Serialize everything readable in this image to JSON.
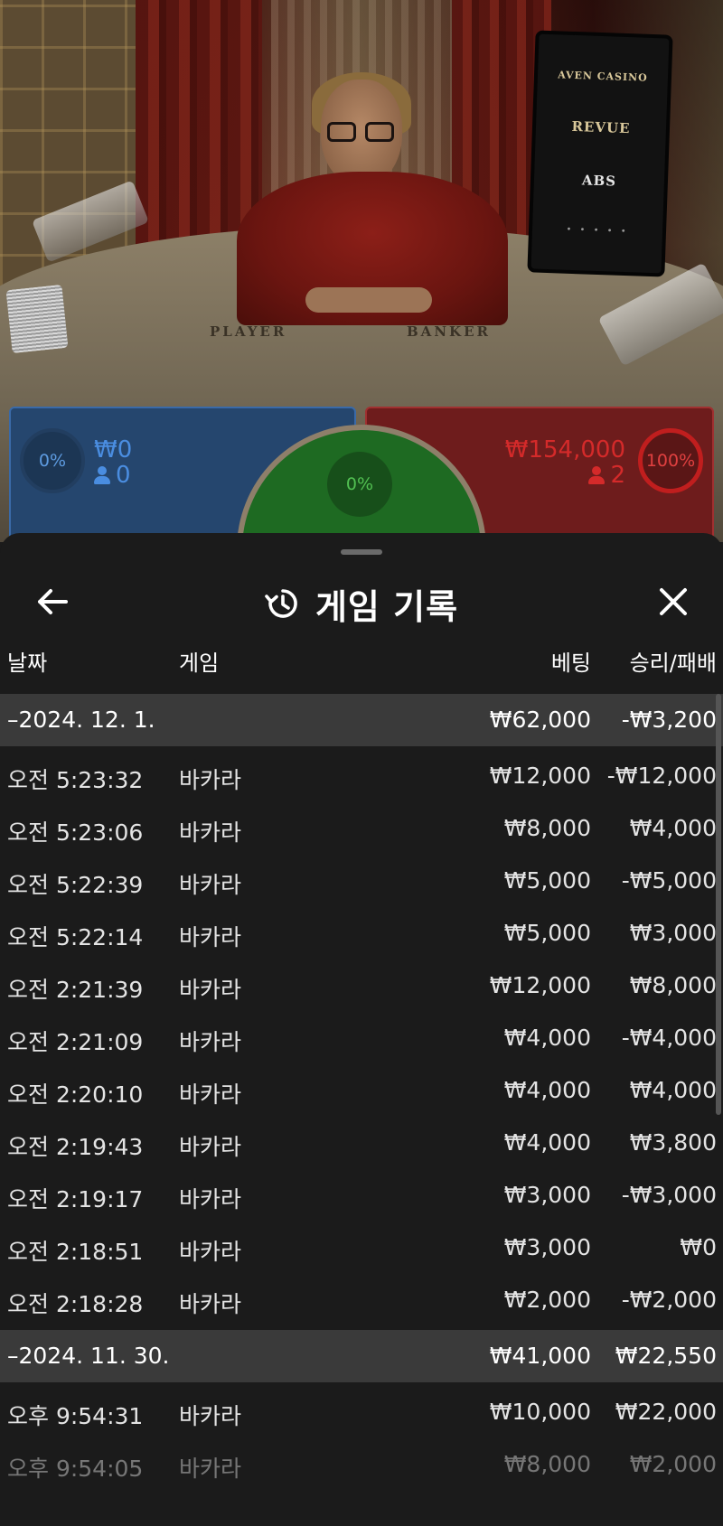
{
  "video": {
    "table_labels": {
      "player": "PLAYER",
      "banker": "BANKER"
    },
    "sponsor": {
      "brands": [
        "AVEN CASINO",
        "REVUE",
        "ABS"
      ]
    }
  },
  "betting": {
    "player": {
      "percent": "0%",
      "amount": "₩0",
      "players": "0"
    },
    "tie": {
      "percent": "0%"
    },
    "banker": {
      "percent": "100%",
      "amount": "₩154,000",
      "players": "2"
    },
    "colors": {
      "player": "#25466e",
      "banker": "#6e1c1c",
      "tie": "#1e6a22"
    }
  },
  "sheet": {
    "title": "게임 기록",
    "icons": {
      "back": "arrow-left-icon",
      "history": "history-icon",
      "close": "close-icon"
    },
    "columns": {
      "date": "날짜",
      "game": "게임",
      "bet": "베팅",
      "result": "승리/패배"
    },
    "groups": [
      {
        "date": "–2024. 12. 1.",
        "bet": "₩62,000",
        "result": "-₩3,200",
        "rows": [
          {
            "time": "오전 5:23:32",
            "game": "바카라",
            "bet": "₩12,000",
            "result": "-₩12,000"
          },
          {
            "time": "오전 5:23:06",
            "game": "바카라",
            "bet": "₩8,000",
            "result": "₩4,000"
          },
          {
            "time": "오전 5:22:39",
            "game": "바카라",
            "bet": "₩5,000",
            "result": "-₩5,000"
          },
          {
            "time": "오전 5:22:14",
            "game": "바카라",
            "bet": "₩5,000",
            "result": "₩3,000"
          },
          {
            "time": "오전 2:21:39",
            "game": "바카라",
            "bet": "₩12,000",
            "result": "₩8,000"
          },
          {
            "time": "오전 2:21:09",
            "game": "바카라",
            "bet": "₩4,000",
            "result": "-₩4,000"
          },
          {
            "time": "오전 2:20:10",
            "game": "바카라",
            "bet": "₩4,000",
            "result": "₩4,000"
          },
          {
            "time": "오전 2:19:43",
            "game": "바카라",
            "bet": "₩4,000",
            "result": "₩3,800"
          },
          {
            "time": "오전 2:19:17",
            "game": "바카라",
            "bet": "₩3,000",
            "result": "-₩3,000"
          },
          {
            "time": "오전 2:18:51",
            "game": "바카라",
            "bet": "₩3,000",
            "result": "₩0"
          },
          {
            "time": "오전 2:18:28",
            "game": "바카라",
            "bet": "₩2,000",
            "result": "-₩2,000"
          }
        ]
      },
      {
        "date": "–2024. 11. 30.",
        "bet": "₩41,000",
        "result": "₩22,550",
        "rows": [
          {
            "time": "오후 9:54:31",
            "game": "바카라",
            "bet": "₩10,000",
            "result": "₩22,000"
          },
          {
            "time": "오후 9:54:05",
            "game": "바카라",
            "bet": "₩8,000",
            "result": "₩2,000"
          }
        ]
      }
    ]
  }
}
